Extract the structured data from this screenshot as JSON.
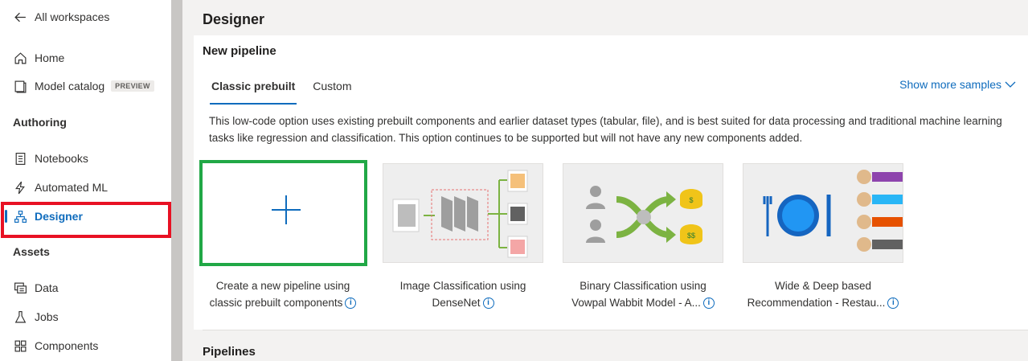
{
  "sidebar": {
    "back_label": "All workspaces",
    "home_label": "Home",
    "model_catalog_label": "Model catalog",
    "preview_badge": "PREVIEW",
    "authoring_heading": "Authoring",
    "notebooks_label": "Notebooks",
    "automl_label": "Automated ML",
    "designer_label": "Designer",
    "assets_heading": "Assets",
    "data_label": "Data",
    "jobs_label": "Jobs",
    "components_label": "Components"
  },
  "main": {
    "page_title": "Designer",
    "new_pipeline_title": "New pipeline",
    "tabs": [
      {
        "label": "Classic prebuilt"
      },
      {
        "label": "Custom"
      }
    ],
    "show_more": "Show more samples",
    "description": "This low-code option uses existing prebuilt components and earlier dataset types (tabular, file), and is best suited for data processing and traditional machine learning tasks like regression and classification. This option continues to be supported but will not have any new components added.",
    "cards": [
      {
        "line1": "Create a new pipeline using",
        "line2": "classic prebuilt components"
      },
      {
        "line1": "Image Classification using",
        "line2": "DenseNet"
      },
      {
        "line1": "Binary Classification using",
        "line2": "Vowpal Wabbit Model - A..."
      },
      {
        "line1": "Wide & Deep based",
        "line2": "Recommendation - Restau..."
      }
    ],
    "pipelines_title": "Pipelines"
  },
  "colors": {
    "accent": "#0f6cbd",
    "highlight_red": "#e81123",
    "highlight_green": "#21a846"
  }
}
